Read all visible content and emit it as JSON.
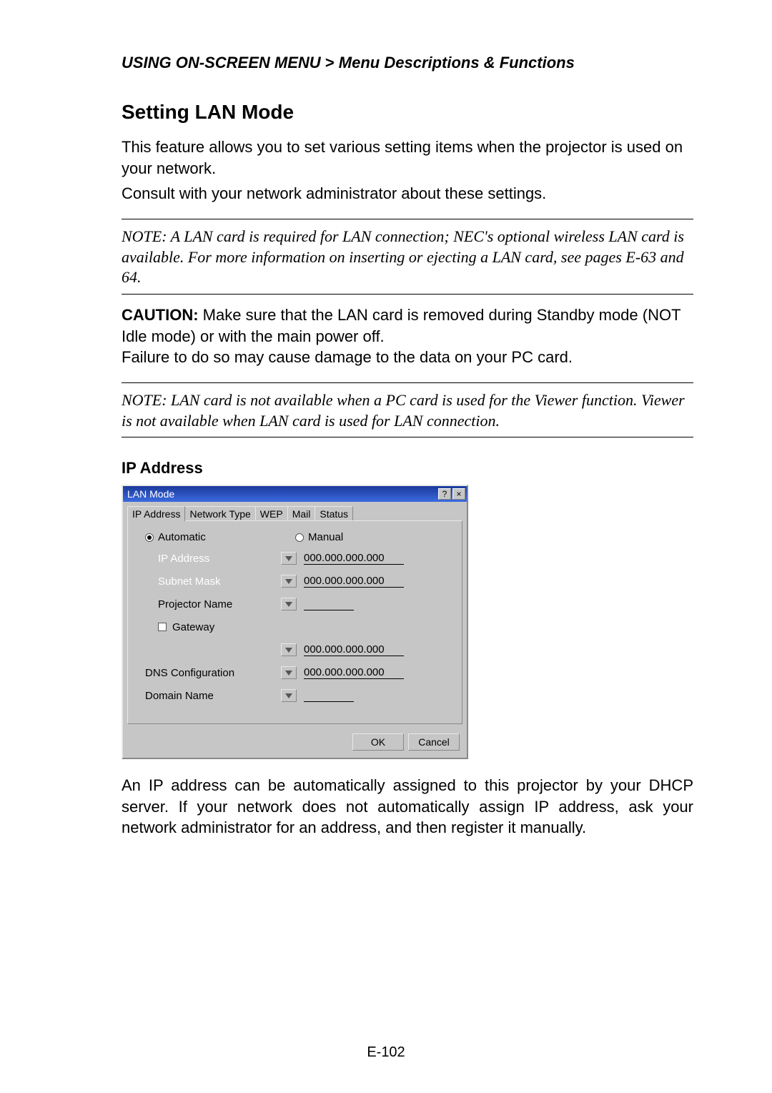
{
  "breadcrumb": {
    "section": "USING ON-SCREEN MENU",
    "separator": ">",
    "sub": "Menu Descriptions & Functions"
  },
  "heading": "Setting LAN Mode",
  "para1": "This feature allows you to set various setting items when the projector is used on your network.",
  "para2": "Consult with your network administrator about these settings.",
  "note1": "NOTE: A LAN card is required for LAN connection; NEC's optional wireless LAN card is available. For more information on inserting or ejecting a LAN card, see pages E-63 and 64.",
  "caution_head": "CAUTION:",
  "caution_body": " Make sure that the LAN card is removed during Standby mode (NOT Idle mode) or with the main power off.",
  "caution_body2": "Failure to do so may cause damage to the data on your PC card.",
  "note2": "NOTE: LAN card is not available when a PC card is used for the Viewer function. Viewer is not available when LAN card is used for LAN connection.",
  "subheading": "IP Address",
  "dialog": {
    "title": "LAN Mode",
    "help": "?",
    "close": "×",
    "tabs": [
      "IP Address",
      "Network Type",
      "WEP",
      "Mail",
      "Status"
    ],
    "active_tab": 0,
    "radio_auto": "Automatic",
    "radio_manual": "Manual",
    "auto_selected": true,
    "fields": {
      "ip_address_label": "IP Address",
      "ip_address_value": "000.000.000.000",
      "subnet_label": "Subnet Mask",
      "subnet_value": "000.000.000.000",
      "projector_label": "Projector Name",
      "projector_value": "",
      "gateway_label": "Gateway",
      "gateway_value": "000.000.000.000",
      "dns_label": "DNS Configuration",
      "dns_value": "000.000.000.000",
      "domain_label": "Domain Name",
      "domain_value": ""
    },
    "ok": "OK",
    "cancel": "Cancel"
  },
  "para3": "An IP address can be automatically assigned to this projector by your DHCP server. If your network does not automatically assign IP address, ask your network administrator for an address, and then register it manually.",
  "page_number": "E-102"
}
